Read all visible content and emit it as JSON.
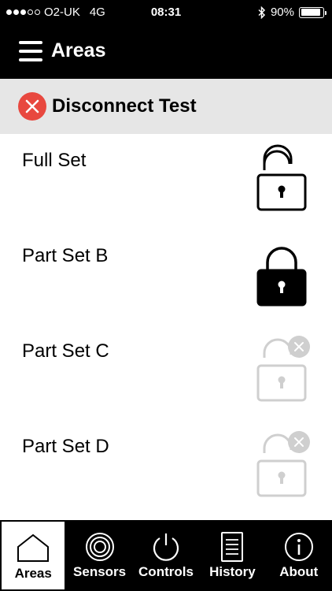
{
  "status_bar": {
    "carrier": "O2-UK",
    "network": "4G",
    "time": "08:31",
    "battery": "90%",
    "battery_level": 0.9,
    "signal_bars": 3
  },
  "header": {
    "title": "Areas"
  },
  "banner": {
    "title": "Disconnect Test"
  },
  "areas": [
    {
      "label": "Full Set",
      "state": "unlocked"
    },
    {
      "label": "Part Set B",
      "state": "locked"
    },
    {
      "label": "Part Set C",
      "state": "unavailable"
    },
    {
      "label": "Part Set D",
      "state": "unavailable"
    }
  ],
  "tabs": [
    {
      "label": "Areas",
      "icon": "house-icon",
      "active": true
    },
    {
      "label": "Sensors",
      "icon": "sensor-icon",
      "active": false
    },
    {
      "label": "Controls",
      "icon": "power-icon",
      "active": false
    },
    {
      "label": "History",
      "icon": "document-icon",
      "active": false
    },
    {
      "label": "About",
      "icon": "info-icon",
      "active": false
    }
  ],
  "colors": {
    "disconnect_red": "#e8483f",
    "disabled_gray": "#cfcfcf",
    "banner_bg": "#e6e6e6"
  }
}
